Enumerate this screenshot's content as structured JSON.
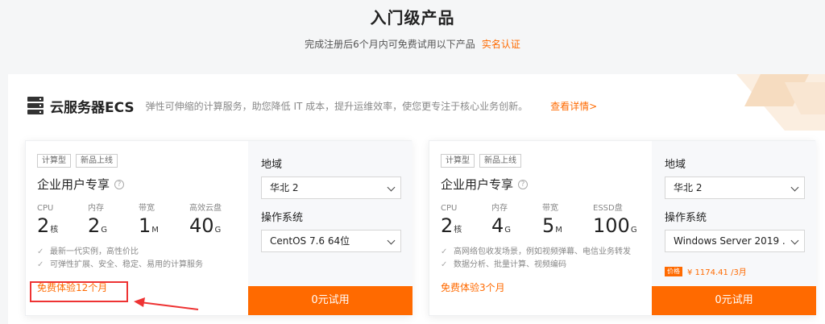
{
  "header": {
    "title": "入门级产品",
    "subtitle": "完成注册后6个月内可免费试用以下产品",
    "verify_link": "实名认证"
  },
  "ecs": {
    "icon": "server-icon",
    "title": "云服务器ECS",
    "description": "弹性可伸缩的计算服务，助您降低 IT 成本，提升运维效率，使您更专注于核心业务创新。",
    "details_link": "查看详情>"
  },
  "cards": [
    {
      "tags": [
        "计算型",
        "新品上线"
      ],
      "title": "企业用户专享",
      "specs": [
        {
          "label": "CPU",
          "value": "2",
          "unit": "核"
        },
        {
          "label": "内存",
          "value": "2",
          "unit": "G"
        },
        {
          "label": "带宽",
          "value": "1",
          "unit": "M"
        },
        {
          "label": "高效云盘",
          "value": "40",
          "unit": "G"
        }
      ],
      "features": [
        "最新一代实例，高性价比",
        "可弹性扩展、安全、稳定、易用的计算服务"
      ],
      "trial": "免费体验12个月",
      "region_label": "地域",
      "region_value": "华北 2",
      "os_label": "操作系统",
      "os_value": "CentOS 7.6 64位",
      "button": "0元试用"
    },
    {
      "tags": [
        "计算型",
        "新品上线"
      ],
      "title": "企业用户专享",
      "specs": [
        {
          "label": "CPU",
          "value": "2",
          "unit": "核"
        },
        {
          "label": "内存",
          "value": "4",
          "unit": "G"
        },
        {
          "label": "带宽",
          "value": "5",
          "unit": "M"
        },
        {
          "label": "ESSD盘",
          "value": "100",
          "unit": "G"
        }
      ],
      "features": [
        "高网络包收发场景，例如视频弹幕、电信业务转发",
        "数据分析、批量计算、视频编码"
      ],
      "trial": "免费体验3个月",
      "region_label": "地域",
      "region_value": "华北 2",
      "os_label": "操作系统",
      "os_value": "Windows Server 2019 ...",
      "price_badge": "价格",
      "price": "¥ 1174.41 /3月",
      "button": "0元试用"
    }
  ],
  "colors": {
    "accent": "#ff6a00",
    "highlight": "#ee3333"
  }
}
